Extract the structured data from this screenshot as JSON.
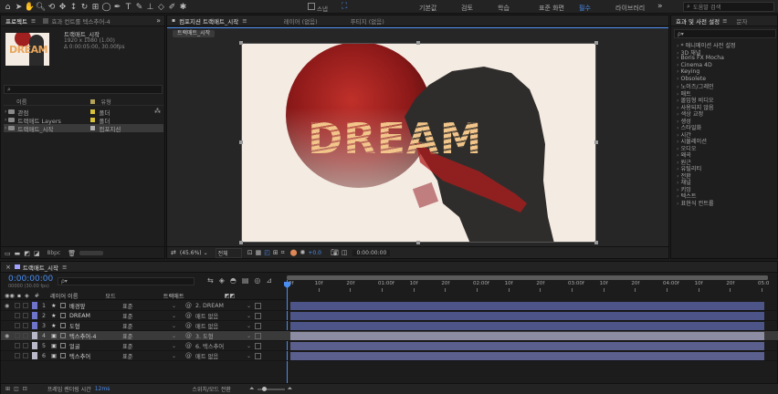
{
  "workspaces": [
    "기본값",
    "검토",
    "학습",
    "표준 화면",
    "필수",
    "라이브러리"
  ],
  "active_workspace": "필수",
  "search_help": "도움말 검색",
  "toolbar_labels": {
    "snap": "스냅",
    "stroke": "선"
  },
  "project": {
    "tab": "프로젝트",
    "tab2": "효과 컨트롤 텍스추어-4",
    "comp_name": "트랙매트_시작",
    "comp_info": [
      "1920 x 1080 (1.00)",
      "Δ 0:00:05:00, 30.00fps"
    ],
    "thumb_text": "DREAM",
    "col_name": "이름",
    "col_type": "유형",
    "items": [
      {
        "name": "관점",
        "type": "폴더",
        "color": "#d8c23a"
      },
      {
        "name": "트랙매트 Layers",
        "type": "폴더",
        "color": "#d8c23a"
      },
      {
        "name": "트랙매트_시작",
        "type": "컴포지션",
        "color": "#b0b0b0"
      }
    ],
    "bpc": "8bpc"
  },
  "viewer": {
    "tabs": [
      "컴포지션 트랙매트_시작",
      "레이어 (없음)",
      "푸티지 (없음)"
    ],
    "breadcrumb": "트랙매트_시작",
    "word": "DREAM",
    "zoom": "(45.6%)",
    "quality": "전체",
    "exposure": "+0.0",
    "timecode": "0:00:00:00"
  },
  "effects": {
    "title": "효과 및 사전 설정",
    "tab2": "문자",
    "search_placeholder": "ρ▾",
    "items": [
      "* 애니메이션 사전 설정",
      "3D 채널",
      "Boris FX Mocha",
      "Cinema 4D",
      "Keying",
      "Obsolete",
      "노이즈/그레인",
      "매트",
      "몰입형 비디오",
      "사용되지 않음",
      "색상 교정",
      "생성",
      "스타일화",
      "시간",
      "시뮬레이션",
      "오디오",
      "왜곡",
      "원근",
      "유틸리티",
      "전환",
      "채널",
      "키잉",
      "텍스트",
      "표현식 컨트롤"
    ]
  },
  "timeline": {
    "tab": "트랙매트_시작",
    "timecode": "0:00:00:00",
    "fps": "00000 (30.00 fps)",
    "col_num": "#",
    "col_layer": "레이어 이름",
    "col_mode": "모드",
    "col_trkmat": "트랙매트",
    "ruler": [
      "0f",
      "10f",
      "20f",
      "01:00f",
      "10f",
      "20f",
      "02:00f",
      "10f",
      "20f",
      "03:00f",
      "10f",
      "20f",
      "04:00f",
      "10f",
      "20f",
      "05:0"
    ],
    "layers": [
      {
        "num": "1",
        "name": "배경앞",
        "mode": "표준",
        "matte": "2. DREAM",
        "label": "#6d74c9",
        "bar": "#4d5488",
        "star": true
      },
      {
        "num": "2",
        "name": "DREAM",
        "mode": "표준",
        "matte": "매트 없음",
        "label": "#6d74c9",
        "bar": "#4d5488",
        "star": true
      },
      {
        "num": "3",
        "name": "도형",
        "mode": "표준",
        "matte": "매트 없음",
        "label": "#6d74c9",
        "bar": "#4d5488",
        "star": true
      },
      {
        "num": "4",
        "name": "텍스추어-4",
        "mode": "표준",
        "matte": "3. 도형",
        "label": "#b8b8c8",
        "bar": "#8c8ca2",
        "star": false
      },
      {
        "num": "5",
        "name": "얼굴",
        "mode": "표준",
        "matte": "6. 텍스추어",
        "label": "#b8b8c8",
        "bar": "#5a5f8e",
        "star": false
      },
      {
        "num": "6",
        "name": "텍스추어",
        "mode": "표준",
        "matte": "매트 없음",
        "label": "#b8b8c8",
        "bar": "#5a5f8e",
        "star": false
      }
    ],
    "footer_render": "프레임 렌더링 시간",
    "footer_ms": "12ms",
    "footer_switch": "스위치/모드 전환"
  }
}
